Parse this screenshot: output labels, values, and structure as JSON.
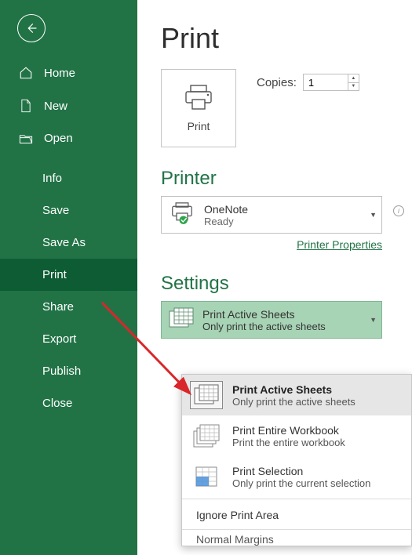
{
  "sidebar": {
    "home": "Home",
    "new": "New",
    "open": "Open",
    "info": "Info",
    "save": "Save",
    "save_as": "Save As",
    "print": "Print",
    "share": "Share",
    "export": "Export",
    "publish": "Publish",
    "close": "Close"
  },
  "main": {
    "title": "Print",
    "print_button": "Print",
    "copies_label": "Copies:",
    "copies_value": "1",
    "printer_heading": "Printer",
    "printer_name": "OneNote",
    "printer_status": "Ready",
    "printer_properties": "Printer Properties",
    "settings_heading": "Settings",
    "settings_combo": {
      "title": "Print Active Sheets",
      "subtitle": "Only print the active sheets"
    },
    "dropdown": {
      "items": [
        {
          "title": "Print Active Sheets",
          "subtitle": "Only print the active sheets"
        },
        {
          "title": "Print Entire Workbook",
          "subtitle": "Print the entire workbook"
        },
        {
          "title": "Print Selection",
          "subtitle": "Only print the current selection"
        }
      ],
      "ignore": "Ignore Print Area",
      "cutoff": "Normal Margins"
    }
  }
}
